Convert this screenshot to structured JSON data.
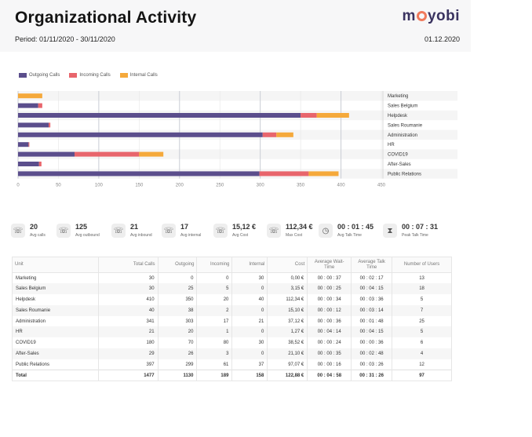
{
  "header": {
    "title": "Organizational Activity",
    "period": "Period: 01/11/2020 - 30/11/2020",
    "date": "01.12.2020",
    "logo": {
      "left": "m",
      "right": "yobi"
    }
  },
  "colors": {
    "outgoing": "#5b4e8c",
    "incoming": "#e8656c",
    "internal": "#f5a93b"
  },
  "chart_data": {
    "type": "bar",
    "orientation": "horizontal",
    "stacked": true,
    "categories": [
      "Marketing",
      "Sales Belgium",
      "Helpdesk",
      "Sales Roumanie",
      "Administration",
      "HR",
      "COVID19",
      "After-Sales",
      "Public Relations"
    ],
    "series": [
      {
        "name": "Outgoing Calls",
        "values": [
          0,
          25,
          350,
          38,
          303,
          13,
          70,
          26,
          299
        ]
      },
      {
        "name": "Incoming Calls",
        "values": [
          0,
          5,
          20,
          2,
          17,
          1,
          80,
          3,
          61
        ]
      },
      {
        "name": "Internal Calls",
        "values": [
          30,
          0,
          40,
          0,
          21,
          0,
          30,
          0,
          37
        ]
      }
    ],
    "xticks": [
      "0",
      "50",
      "100",
      "150",
      "200",
      "250",
      "300",
      "350",
      "400",
      "450"
    ],
    "xlim": [
      0,
      450
    ],
    "legend_position": "top-left",
    "grid": true
  },
  "stats": [
    {
      "icon": "phone-icon",
      "value": "20",
      "label": "Avg calls"
    },
    {
      "icon": "phone-outgoing-icon",
      "value": "125",
      "label": "Avg outbound"
    },
    {
      "icon": "phone-incoming-icon",
      "value": "21",
      "label": "Avg inbound"
    },
    {
      "icon": "phone-internal-icon",
      "value": "17",
      "label": "Avg internal"
    },
    {
      "icon": "cost-icon",
      "value": "15,12 €",
      "label": "Avg Cost"
    },
    {
      "icon": "max-cost-icon",
      "value": "112,34 €",
      "label": "Max Cost"
    },
    {
      "icon": "clock-icon",
      "value": "00 : 01 : 45",
      "label": "Avg Talk Time"
    },
    {
      "icon": "hourglass-icon",
      "value": "00 : 07 : 31",
      "label": "Peak Talk Time"
    }
  ],
  "table": {
    "headers": [
      "Unit",
      "Total Calls",
      "Outgoing",
      "Incoming",
      "Internal",
      "Cost",
      "Average Wait-Time",
      "Average Talk Time",
      "Number of Users"
    ],
    "rows": [
      [
        "Marketing",
        "30",
        "0",
        "0",
        "30",
        "0,00 €",
        "00 : 00 : 37",
        "00 : 02 : 17",
        "13"
      ],
      [
        "Sales Belgium",
        "30",
        "25",
        "5",
        "0",
        "3,15 €",
        "00 : 00 : 25",
        "00 : 04 : 15",
        "18"
      ],
      [
        "Helpdesk",
        "410",
        "350",
        "20",
        "40",
        "112,34 €",
        "00 : 00 : 34",
        "00 : 03 : 36",
        "5"
      ],
      [
        "Sales Roumanie",
        "40",
        "38",
        "2",
        "0",
        "15,10 €",
        "00 : 00 : 12",
        "00 : 03 : 14",
        "7"
      ],
      [
        "Administration",
        "341",
        "303",
        "17",
        "21",
        "37,12 €",
        "00 : 00 : 36",
        "00 : 01 : 48",
        "25"
      ],
      [
        "HR",
        "21",
        "20",
        "1",
        "0",
        "1,27 €",
        "00 : 04 : 14",
        "00 : 04 : 15",
        "5"
      ],
      [
        "COVID19",
        "180",
        "70",
        "80",
        "30",
        "38,52 €",
        "00 : 00 : 24",
        "00 : 00 : 36",
        "6"
      ],
      [
        "After-Sales",
        "29",
        "26",
        "3",
        "0",
        "21,10 €",
        "00 : 00 : 35",
        "00 : 02 : 48",
        "4"
      ],
      [
        "Public Relations",
        "397",
        "299",
        "61",
        "37",
        "97,07 €",
        "00 : 00 : 16",
        "00 : 03 : 26",
        "12"
      ]
    ],
    "total": [
      "Total",
      "1477",
      "1130",
      "189",
      "158",
      "122,88 €",
      "00 : 04 : 58",
      "00 : 31 : 26",
      "97"
    ]
  }
}
